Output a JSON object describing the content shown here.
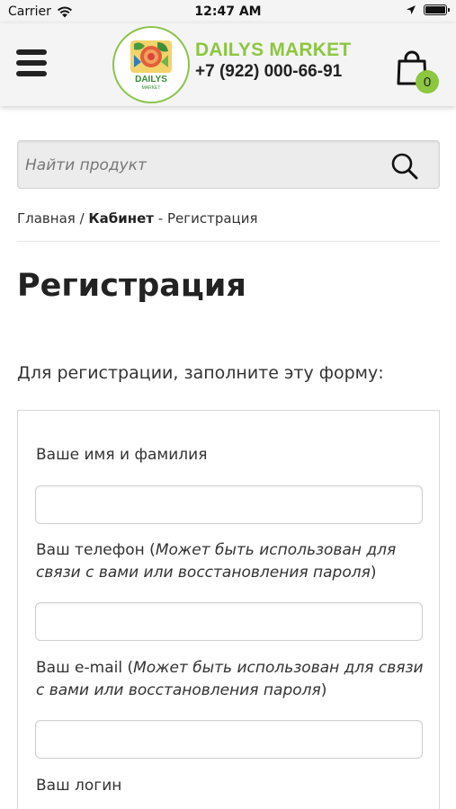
{
  "status_bar": {
    "carrier": "Carrier",
    "time": "12:47 AM"
  },
  "header": {
    "brand_name": "DAILYS MARKET",
    "phone": "+7 (922) 000-66-91",
    "cart_count": "0",
    "logo_text": "DAILYS",
    "logo_subtext": "MARKET",
    "accent_color": "#8dc63f"
  },
  "search": {
    "placeholder": "Найти продукт"
  },
  "breadcrumb": {
    "home": "Главная",
    "sep": " / ",
    "section": "Кабинет",
    "dash": " - ",
    "current": "Регистрация"
  },
  "page": {
    "title": "Регистрация",
    "intro": "Для регистрации, заполните эту форму:"
  },
  "form": {
    "name_label": "Ваше имя и фамилия",
    "phone_label": "Ваш телефон (",
    "phone_hint": "Может быть использован для связи с вами или восстановления пароля",
    "phone_close": ")",
    "email_label": "Ваш e-mail (",
    "email_hint": "Может быть использован для связи с вами или восстановления пароля",
    "email_close": ")",
    "login_label": "Ваш логин"
  }
}
